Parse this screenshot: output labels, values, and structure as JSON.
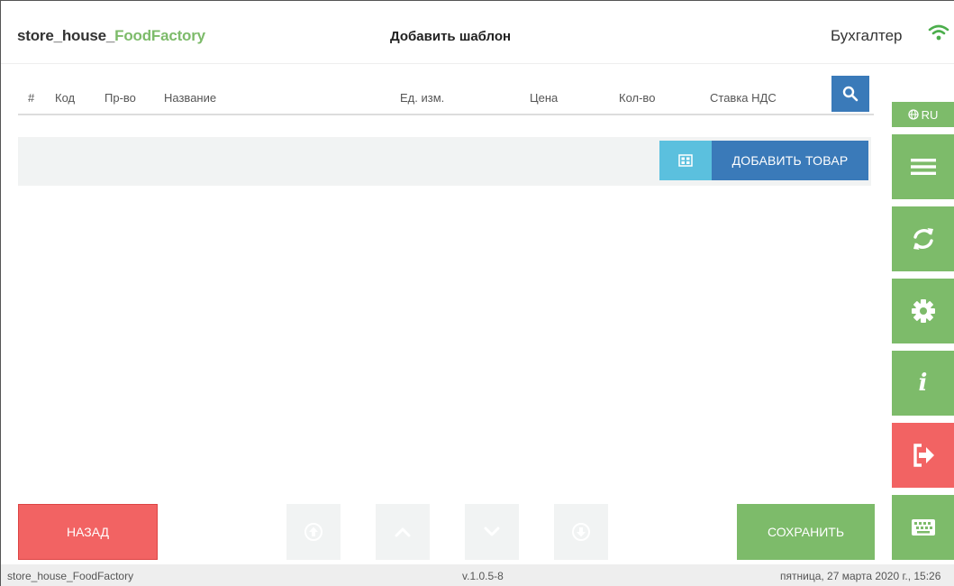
{
  "header": {
    "app_name_prefix": "store_house_",
    "app_name_accent": "FoodFactory",
    "page_title": "Добавить шаблон",
    "user_role": "Бухгалтер"
  },
  "table": {
    "columns": [
      "#",
      "Код",
      "Пр-во",
      "Название",
      "Ед. изм.",
      "Цена",
      "Кол-во",
      "Ставка НДС"
    ]
  },
  "add_row": {
    "add_goods_label": "ДОБАВИТЬ ТОВАР"
  },
  "sidebar": {
    "language": "RU",
    "buttons": [
      {
        "icon": "menu-icon"
      },
      {
        "icon": "sync-icon"
      },
      {
        "icon": "gear-icon"
      },
      {
        "icon": "info-icon",
        "glyph": "i"
      },
      {
        "icon": "logout-icon"
      },
      {
        "icon": "keyboard-icon"
      }
    ]
  },
  "footer": {
    "back_label": "НАЗАД",
    "save_label": "СОХРАНИТЬ"
  },
  "status_bar": {
    "app_name": "store_house_FoodFactory",
    "version": "v.1.0.5-8",
    "datetime": "пятница, 27 марта 2020 г., 15:26"
  },
  "colors": {
    "green": "#7dbb6a",
    "blue": "#3a7ab9",
    "light_blue": "#5bc0de",
    "red": "#f26363",
    "light_gray": "#f1f3f3"
  }
}
